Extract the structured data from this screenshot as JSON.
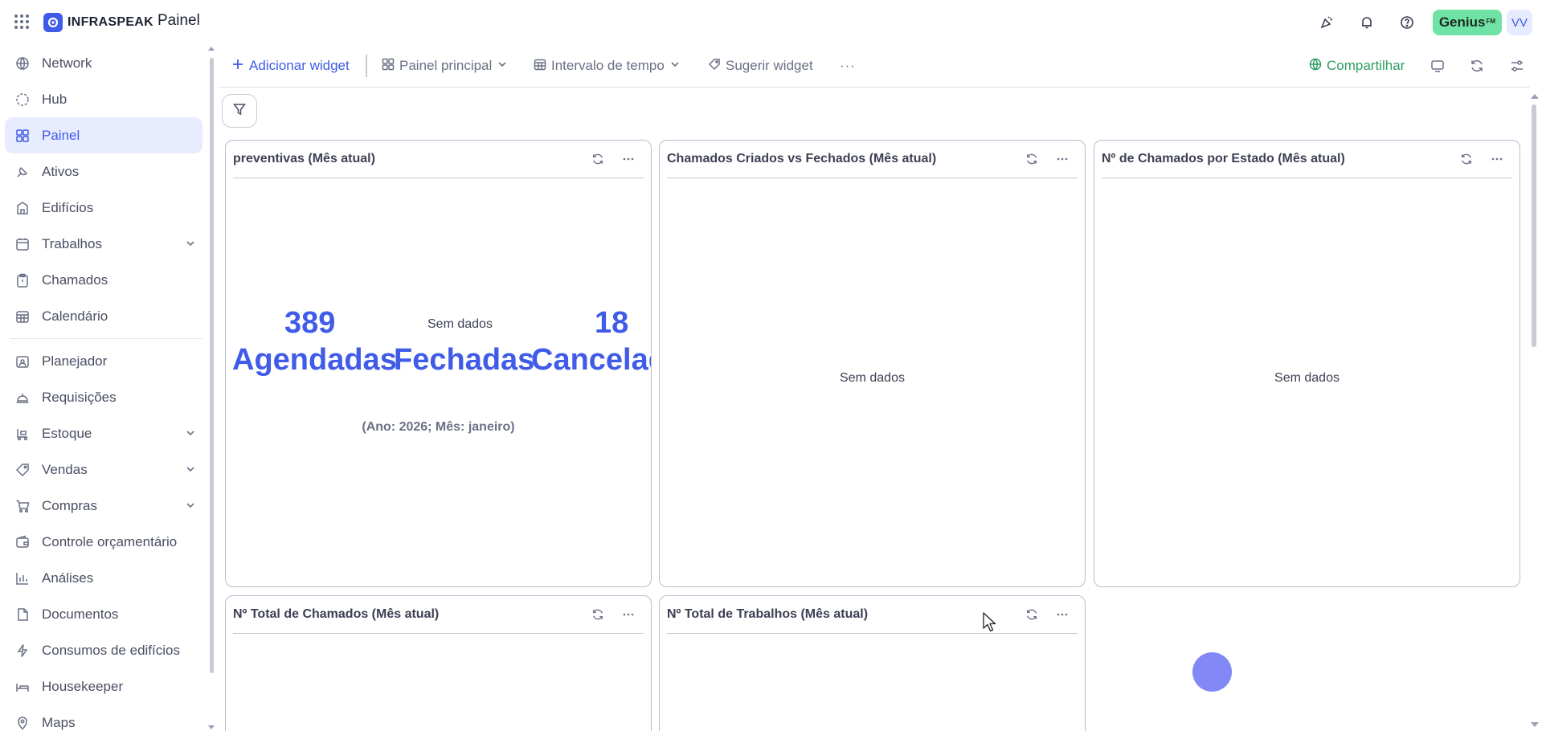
{
  "app": {
    "brand": "INFRASPEAK",
    "page_title": "Painel",
    "genius_label": "Genius",
    "genius_sup": "FM",
    "avatar_initials": "VV"
  },
  "sidebar": {
    "items": [
      {
        "label": "Network",
        "icon": "network-icon"
      },
      {
        "label": "Hub",
        "icon": "hub-icon"
      },
      {
        "label": "Painel",
        "icon": "dashboard-icon",
        "active": true
      },
      {
        "label": "Ativos",
        "icon": "assets-icon"
      },
      {
        "label": "Edifícios",
        "icon": "building-icon"
      },
      {
        "label": "Trabalhos",
        "icon": "calendar-icon",
        "expandable": true
      },
      {
        "label": "Chamados",
        "icon": "clipboard-icon"
      },
      {
        "label": "Calendário",
        "icon": "calendar-grid-icon"
      },
      {
        "label": "Planejador",
        "icon": "planner-icon"
      },
      {
        "label": "Requisições",
        "icon": "bell-service-icon"
      },
      {
        "label": "Estoque",
        "icon": "forklift-icon",
        "expandable": true
      },
      {
        "label": "Vendas",
        "icon": "tag-icon",
        "expandable": true
      },
      {
        "label": "Compras",
        "icon": "cart-icon",
        "expandable": true
      },
      {
        "label": "Controle orçamentário",
        "icon": "wallet-icon"
      },
      {
        "label": "Análises",
        "icon": "bar-chart-icon"
      },
      {
        "label": "Documentos",
        "icon": "document-icon"
      },
      {
        "label": "Consumos de edifícios",
        "icon": "lightning-icon"
      },
      {
        "label": "Housekeeper",
        "icon": "bed-icon"
      },
      {
        "label": "Maps",
        "icon": "map-pin-icon"
      }
    ]
  },
  "toolbar": {
    "add_widget": "Adicionar widget",
    "main_panel": "Painel principal",
    "time_range": "Intervalo de tempo",
    "suggest_widget": "Sugerir widget",
    "more": "···",
    "share": "Compartilhar"
  },
  "widgets": {
    "preventivas": {
      "title": "preventivas (Mês atual)",
      "kpi_scheduled_value": "389",
      "kpi_scheduled_label": "Agendadas",
      "kpi_closed_empty": "Sem dados",
      "kpi_closed_label": "Fechadas",
      "kpi_cancelled_value": "18",
      "kpi_cancelled_label": "Cancelad",
      "caption": "(Ano: 2026; Mês: janeiro)"
    },
    "created_vs_closed": {
      "title": "Chamados Criados vs Fechados (Mês atual)",
      "empty": "Sem dados"
    },
    "by_state": {
      "title": "Nº de Chamados por Estado (Mês atual)",
      "empty": "Sem dados"
    },
    "total_calls": {
      "title": "Nº Total de Chamados (Mês atual)"
    },
    "total_jobs": {
      "title": "Nº Total de Trabalhos (Mês atual)"
    }
  },
  "colors": {
    "accent": "#3f5be8",
    "share": "#2e9e63",
    "genius": "#6fe3a6",
    "active_nav_bg": "#e8ecff",
    "loader": "#8288f5"
  }
}
